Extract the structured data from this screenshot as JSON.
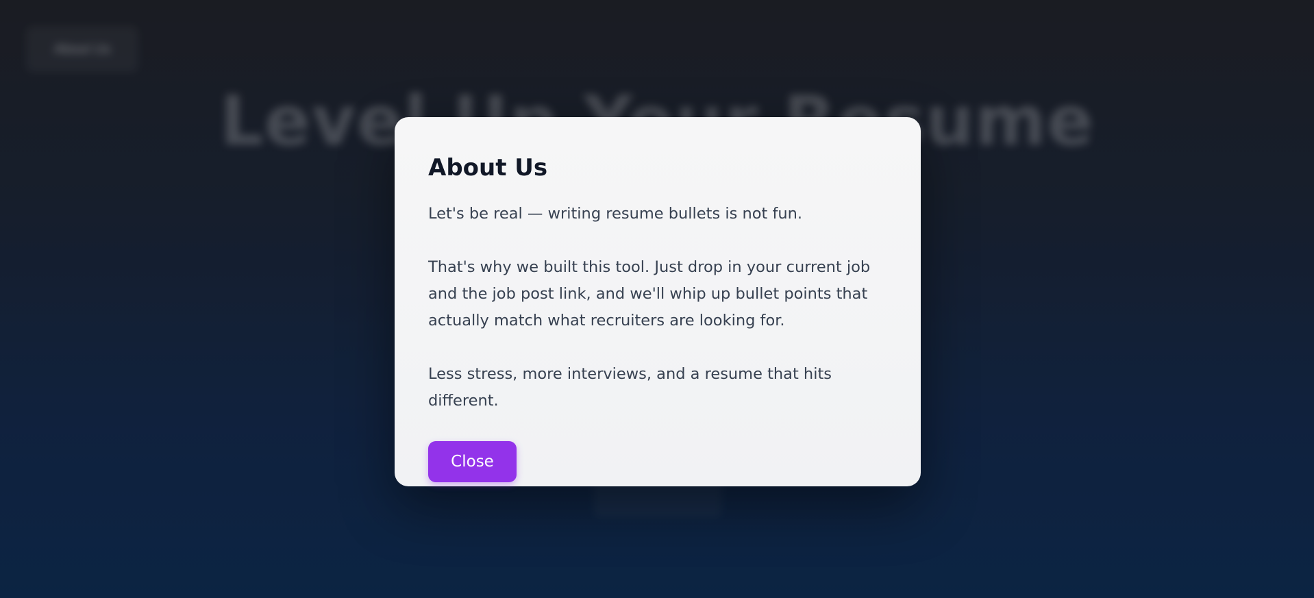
{
  "background": {
    "about_button_label": "About Us",
    "hero_title": "Level Up Your Resume"
  },
  "modal": {
    "title": "About Us",
    "paragraphs": [
      "Let's be real — writing resume bullets is not fun.",
      "That's why we built this tool. Just drop in your current job and the job post link, and we'll whip up bullet points that actually match what recruiters are looking for.",
      "Less stress, more interviews, and a resume that hits different."
    ],
    "close_label": "Close"
  },
  "colors": {
    "accent": "#9333ea",
    "modal_bg": "#f3f4f6",
    "title_text": "#111827",
    "body_text": "#374151"
  }
}
